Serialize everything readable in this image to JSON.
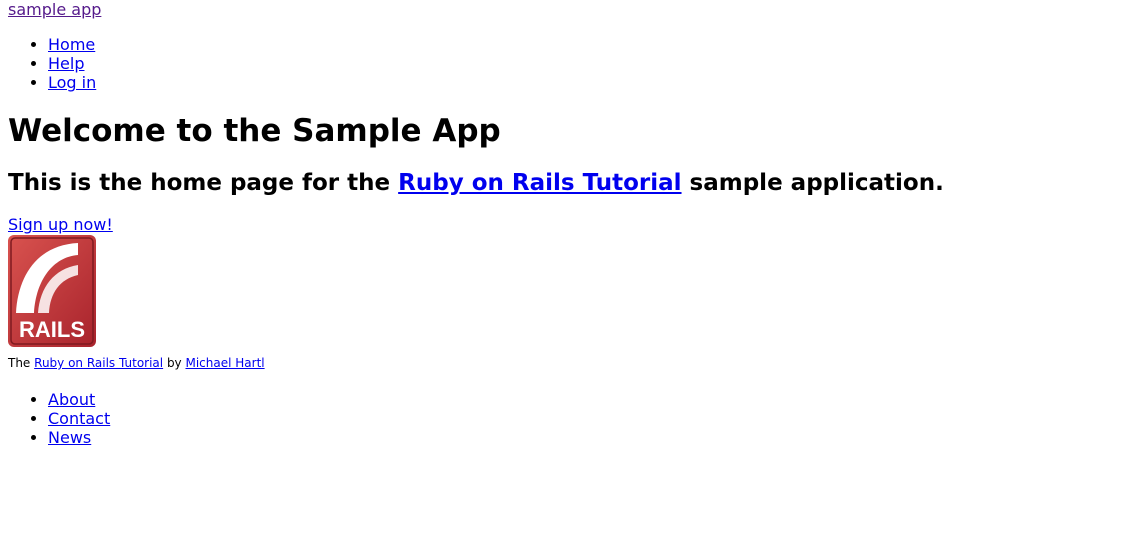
{
  "header": {
    "logo_text": "sample app",
    "nav": [
      "Home",
      "Help",
      "Log in"
    ]
  },
  "main": {
    "heading": "Welcome to the Sample App",
    "subheading_prefix": "This is the home page for the ",
    "subheading_link": "Ruby on Rails Tutorial",
    "subheading_suffix": " sample application.",
    "signup_label": "Sign up now!",
    "rails_logo_text": "RAILS"
  },
  "footer": {
    "credit_prefix": "The ",
    "credit_link": "Ruby on Rails Tutorial",
    "credit_by": " by ",
    "credit_author": "Michael Hartl",
    "nav": [
      "About",
      "Contact",
      "News"
    ]
  },
  "colors": {
    "link": "#0000ee",
    "visited": "#551a8b",
    "rails_red": "#c4313a"
  }
}
